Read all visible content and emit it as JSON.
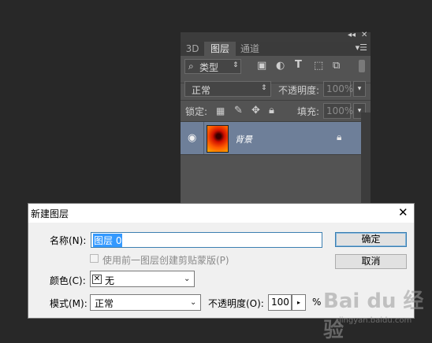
{
  "panel": {
    "tabs": [
      "3D",
      "图层",
      "通道"
    ],
    "active_tab": "图层",
    "filter_type": "类型",
    "blend_mode": "正常",
    "opacity_label": "不透明度:",
    "opacity_value": "100%",
    "lock_label": "锁定:",
    "fill_label": "填充:",
    "fill_value": "100%",
    "layer_name": "背景"
  },
  "dialog": {
    "title": "新建图层",
    "name_label": "名称(N):",
    "name_value": "图层 0",
    "clip_label": "使用前一图层创建剪贴蒙版(P)",
    "color_label": "颜色(C):",
    "color_value": "无",
    "mode_label": "模式(M):",
    "mode_value": "正常",
    "opacity_label": "不透明度(O):",
    "opacity_value": "100",
    "opacity_unit": "%",
    "ok_button": "确定",
    "cancel_button": "取消"
  },
  "watermark": {
    "brand": "Bai du 经验",
    "site": "jingyan.baidu.com"
  }
}
